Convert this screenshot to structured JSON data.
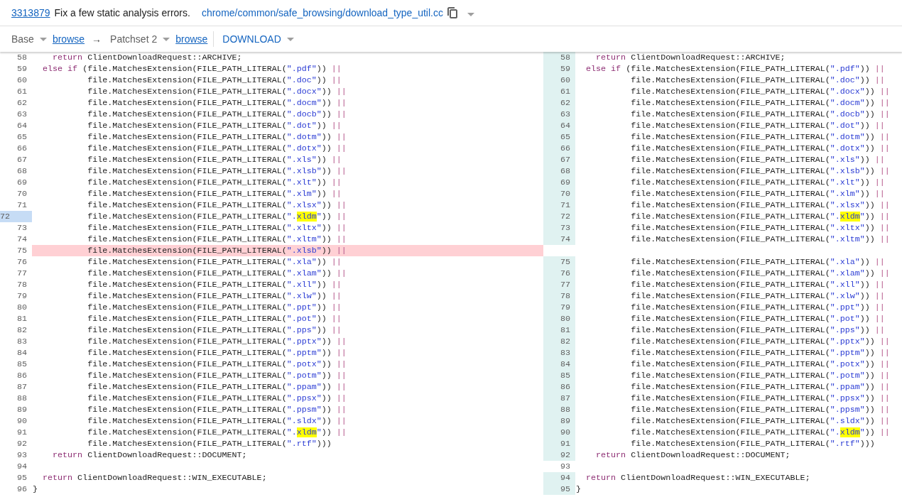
{
  "header": {
    "change_number": "3313879",
    "subject": "Fix a few static analysis errors.",
    "file_path": "chrome/common/safe_browsing/download_type_util.cc"
  },
  "patch_bar": {
    "base": "Base",
    "base_browse": "browse",
    "arrow": "→",
    "patchset": "Patchset 2",
    "patchset_browse": "browse",
    "download": "DOWNLOAD"
  },
  "left": {
    "rows": [
      {
        "number": "58",
        "kind": "context",
        "selected": false,
        "tokens": [
          {
            "kind": "keyword",
            "text": "    return"
          },
          {
            "kind": "plain",
            "text": " ClientDownloadRequest::ARCHIVE;"
          }
        ]
      },
      {
        "number": "59",
        "kind": "context",
        "selected": false,
        "tokens": [
          {
            "kind": "keyword",
            "text": "  else if"
          },
          {
            "kind": "plain",
            "text": " (file.MatchesExtension(FILE_PATH_LITERAL("
          },
          {
            "kind": "string",
            "text": "\".pdf\""
          },
          {
            "kind": "plain",
            "text": ")) "
          },
          {
            "kind": "operator",
            "text": "||"
          }
        ]
      },
      {
        "number": "60",
        "kind": "context",
        "selected": false,
        "tokens": [
          {
            "kind": "plain",
            "text": "           file.MatchesExtension(FILE_PATH_LITERAL("
          },
          {
            "kind": "string",
            "text": "\".doc\""
          },
          {
            "kind": "plain",
            "text": ")) "
          },
          {
            "kind": "operator",
            "text": "||"
          }
        ]
      },
      {
        "number": "61",
        "kind": "context",
        "selected": false,
        "tokens": [
          {
            "kind": "plain",
            "text": "           file.MatchesExtension(FILE_PATH_LITERAL("
          },
          {
            "kind": "string",
            "text": "\".docx\""
          },
          {
            "kind": "plain",
            "text": ")) "
          },
          {
            "kind": "operator",
            "text": "||"
          }
        ]
      },
      {
        "number": "62",
        "kind": "context",
        "selected": false,
        "tokens": [
          {
            "kind": "plain",
            "text": "           file.MatchesExtension(FILE_PATH_LITERAL("
          },
          {
            "kind": "string",
            "text": "\".docm\""
          },
          {
            "kind": "plain",
            "text": ")) "
          },
          {
            "kind": "operator",
            "text": "||"
          }
        ]
      },
      {
        "number": "63",
        "kind": "context",
        "selected": false,
        "tokens": [
          {
            "kind": "plain",
            "text": "           file.MatchesExtension(FILE_PATH_LITERAL("
          },
          {
            "kind": "string",
            "text": "\".docb\""
          },
          {
            "kind": "plain",
            "text": ")) "
          },
          {
            "kind": "operator",
            "text": "||"
          }
        ]
      },
      {
        "number": "64",
        "kind": "context",
        "selected": false,
        "tokens": [
          {
            "kind": "plain",
            "text": "           file.MatchesExtension(FILE_PATH_LITERAL("
          },
          {
            "kind": "string",
            "text": "\".dot\""
          },
          {
            "kind": "plain",
            "text": ")) "
          },
          {
            "kind": "operator",
            "text": "||"
          }
        ]
      },
      {
        "number": "65",
        "kind": "context",
        "selected": false,
        "tokens": [
          {
            "kind": "plain",
            "text": "           file.MatchesExtension(FILE_PATH_LITERAL("
          },
          {
            "kind": "string",
            "text": "\".dotm\""
          },
          {
            "kind": "plain",
            "text": ")) "
          },
          {
            "kind": "operator",
            "text": "||"
          }
        ]
      },
      {
        "number": "66",
        "kind": "context",
        "selected": false,
        "tokens": [
          {
            "kind": "plain",
            "text": "           file.MatchesExtension(FILE_PATH_LITERAL("
          },
          {
            "kind": "string",
            "text": "\".dotx\""
          },
          {
            "kind": "plain",
            "text": ")) "
          },
          {
            "kind": "operator",
            "text": "||"
          }
        ]
      },
      {
        "number": "67",
        "kind": "context",
        "selected": false,
        "tokens": [
          {
            "kind": "plain",
            "text": "           file.MatchesExtension(FILE_PATH_LITERAL("
          },
          {
            "kind": "string",
            "text": "\".xls\""
          },
          {
            "kind": "plain",
            "text": ")) "
          },
          {
            "kind": "operator",
            "text": "||"
          }
        ]
      },
      {
        "number": "68",
        "kind": "context",
        "selected": false,
        "tokens": [
          {
            "kind": "plain",
            "text": "           file.MatchesExtension(FILE_PATH_LITERAL("
          },
          {
            "kind": "string",
            "text": "\".xlsb\""
          },
          {
            "kind": "plain",
            "text": ")) "
          },
          {
            "kind": "operator",
            "text": "||"
          }
        ]
      },
      {
        "number": "69",
        "kind": "context",
        "selected": false,
        "tokens": [
          {
            "kind": "plain",
            "text": "           file.MatchesExtension(FILE_PATH_LITERAL("
          },
          {
            "kind": "string",
            "text": "\".xlt\""
          },
          {
            "kind": "plain",
            "text": ")) "
          },
          {
            "kind": "operator",
            "text": "||"
          }
        ]
      },
      {
        "number": "70",
        "kind": "context",
        "selected": false,
        "tokens": [
          {
            "kind": "plain",
            "text": "           file.MatchesExtension(FILE_PATH_LITERAL("
          },
          {
            "kind": "string",
            "text": "\".xlm\""
          },
          {
            "kind": "plain",
            "text": ")) "
          },
          {
            "kind": "operator",
            "text": "||"
          }
        ]
      },
      {
        "number": "71",
        "kind": "context",
        "selected": false,
        "tokens": [
          {
            "kind": "plain",
            "text": "           file.MatchesExtension(FILE_PATH_LITERAL("
          },
          {
            "kind": "string",
            "text": "\".xlsx\""
          },
          {
            "kind": "plain",
            "text": ")) "
          },
          {
            "kind": "operator",
            "text": "||"
          }
        ]
      },
      {
        "number": "72",
        "kind": "context",
        "selected": true,
        "tokens": [
          {
            "kind": "plain",
            "text": "           file.MatchesExtension(FILE_PATH_LITERAL("
          },
          {
            "kind": "string",
            "text": "\"."
          },
          {
            "kind": "match",
            "text": "xldm"
          },
          {
            "kind": "string",
            "text": "\""
          },
          {
            "kind": "plain",
            "text": ")) "
          },
          {
            "kind": "operator",
            "text": "||"
          }
        ]
      },
      {
        "number": "73",
        "kind": "context",
        "selected": false,
        "tokens": [
          {
            "kind": "plain",
            "text": "           file.MatchesExtension(FILE_PATH_LITERAL("
          },
          {
            "kind": "string",
            "text": "\".xltx\""
          },
          {
            "kind": "plain",
            "text": ")) "
          },
          {
            "kind": "operator",
            "text": "||"
          }
        ]
      },
      {
        "number": "74",
        "kind": "context",
        "selected": false,
        "tokens": [
          {
            "kind": "plain",
            "text": "           file.MatchesExtension(FILE_PATH_LITERAL("
          },
          {
            "kind": "string",
            "text": "\".xltm\""
          },
          {
            "kind": "plain",
            "text": ")) "
          },
          {
            "kind": "operator",
            "text": "||"
          }
        ]
      },
      {
        "number": "75",
        "kind": "removed",
        "selected": false,
        "tokens": [
          {
            "kind": "plain",
            "text": "           file.MatchesExtension(FILE_PATH_LITERAL("
          },
          {
            "kind": "string",
            "text": "\".xlsb\""
          },
          {
            "kind": "plain",
            "text": ")) "
          },
          {
            "kind": "operator",
            "text": "||"
          }
        ]
      },
      {
        "number": "76",
        "kind": "context",
        "selected": false,
        "tokens": [
          {
            "kind": "plain",
            "text": "           file.MatchesExtension(FILE_PATH_LITERAL("
          },
          {
            "kind": "string",
            "text": "\".xla\""
          },
          {
            "kind": "plain",
            "text": ")) "
          },
          {
            "kind": "operator",
            "text": "||"
          }
        ]
      },
      {
        "number": "77",
        "kind": "context",
        "selected": false,
        "tokens": [
          {
            "kind": "plain",
            "text": "           file.MatchesExtension(FILE_PATH_LITERAL("
          },
          {
            "kind": "string",
            "text": "\".xlam\""
          },
          {
            "kind": "plain",
            "text": ")) "
          },
          {
            "kind": "operator",
            "text": "||"
          }
        ]
      },
      {
        "number": "78",
        "kind": "context",
        "selected": false,
        "tokens": [
          {
            "kind": "plain",
            "text": "           file.MatchesExtension(FILE_PATH_LITERAL("
          },
          {
            "kind": "string",
            "text": "\".xll\""
          },
          {
            "kind": "plain",
            "text": ")) "
          },
          {
            "kind": "operator",
            "text": "||"
          }
        ]
      },
      {
        "number": "79",
        "kind": "context",
        "selected": false,
        "tokens": [
          {
            "kind": "plain",
            "text": "           file.MatchesExtension(FILE_PATH_LITERAL("
          },
          {
            "kind": "string",
            "text": "\".xlw\""
          },
          {
            "kind": "plain",
            "text": ")) "
          },
          {
            "kind": "operator",
            "text": "||"
          }
        ]
      },
      {
        "number": "80",
        "kind": "context",
        "selected": false,
        "tokens": [
          {
            "kind": "plain",
            "text": "           file.MatchesExtension(FILE_PATH_LITERAL("
          },
          {
            "kind": "string",
            "text": "\".ppt\""
          },
          {
            "kind": "plain",
            "text": ")) "
          },
          {
            "kind": "operator",
            "text": "||"
          }
        ]
      },
      {
        "number": "81",
        "kind": "context",
        "selected": false,
        "tokens": [
          {
            "kind": "plain",
            "text": "           file.MatchesExtension(FILE_PATH_LITERAL("
          },
          {
            "kind": "string",
            "text": "\".pot\""
          },
          {
            "kind": "plain",
            "text": ")) "
          },
          {
            "kind": "operator",
            "text": "||"
          }
        ]
      },
      {
        "number": "82",
        "kind": "context",
        "selected": false,
        "tokens": [
          {
            "kind": "plain",
            "text": "           file.MatchesExtension(FILE_PATH_LITERAL("
          },
          {
            "kind": "string",
            "text": "\".pps\""
          },
          {
            "kind": "plain",
            "text": ")) "
          },
          {
            "kind": "operator",
            "text": "||"
          }
        ]
      },
      {
        "number": "83",
        "kind": "context",
        "selected": false,
        "tokens": [
          {
            "kind": "plain",
            "text": "           file.MatchesExtension(FILE_PATH_LITERAL("
          },
          {
            "kind": "string",
            "text": "\".pptx\""
          },
          {
            "kind": "plain",
            "text": ")) "
          },
          {
            "kind": "operator",
            "text": "||"
          }
        ]
      },
      {
        "number": "84",
        "kind": "context",
        "selected": false,
        "tokens": [
          {
            "kind": "plain",
            "text": "           file.MatchesExtension(FILE_PATH_LITERAL("
          },
          {
            "kind": "string",
            "text": "\".pptm\""
          },
          {
            "kind": "plain",
            "text": ")) "
          },
          {
            "kind": "operator",
            "text": "||"
          }
        ]
      },
      {
        "number": "85",
        "kind": "context",
        "selected": false,
        "tokens": [
          {
            "kind": "plain",
            "text": "           file.MatchesExtension(FILE_PATH_LITERAL("
          },
          {
            "kind": "string",
            "text": "\".potx\""
          },
          {
            "kind": "plain",
            "text": ")) "
          },
          {
            "kind": "operator",
            "text": "||"
          }
        ]
      },
      {
        "number": "86",
        "kind": "context",
        "selected": false,
        "tokens": [
          {
            "kind": "plain",
            "text": "           file.MatchesExtension(FILE_PATH_LITERAL("
          },
          {
            "kind": "string",
            "text": "\".potm\""
          },
          {
            "kind": "plain",
            "text": ")) "
          },
          {
            "kind": "operator",
            "text": "||"
          }
        ]
      },
      {
        "number": "87",
        "kind": "context",
        "selected": false,
        "tokens": [
          {
            "kind": "plain",
            "text": "           file.MatchesExtension(FILE_PATH_LITERAL("
          },
          {
            "kind": "string",
            "text": "\".ppam\""
          },
          {
            "kind": "plain",
            "text": ")) "
          },
          {
            "kind": "operator",
            "text": "||"
          }
        ]
      },
      {
        "number": "88",
        "kind": "context",
        "selected": false,
        "tokens": [
          {
            "kind": "plain",
            "text": "           file.MatchesExtension(FILE_PATH_LITERAL("
          },
          {
            "kind": "string",
            "text": "\".ppsx\""
          },
          {
            "kind": "plain",
            "text": ")) "
          },
          {
            "kind": "operator",
            "text": "||"
          }
        ]
      },
      {
        "number": "89",
        "kind": "context",
        "selected": false,
        "tokens": [
          {
            "kind": "plain",
            "text": "           file.MatchesExtension(FILE_PATH_LITERAL("
          },
          {
            "kind": "string",
            "text": "\".ppsm\""
          },
          {
            "kind": "plain",
            "text": ")) "
          },
          {
            "kind": "operator",
            "text": "||"
          }
        ]
      },
      {
        "number": "90",
        "kind": "context",
        "selected": false,
        "tokens": [
          {
            "kind": "plain",
            "text": "           file.MatchesExtension(FILE_PATH_LITERAL("
          },
          {
            "kind": "string",
            "text": "\".sldx\""
          },
          {
            "kind": "plain",
            "text": ")) "
          },
          {
            "kind": "operator",
            "text": "||"
          }
        ]
      },
      {
        "number": "91",
        "kind": "context",
        "selected": false,
        "tokens": [
          {
            "kind": "plain",
            "text": "           file.MatchesExtension(FILE_PATH_LITERAL("
          },
          {
            "kind": "string",
            "text": "\"."
          },
          {
            "kind": "match",
            "text": "xldm"
          },
          {
            "kind": "string",
            "text": "\""
          },
          {
            "kind": "plain",
            "text": ")) "
          },
          {
            "kind": "operator",
            "text": "||"
          }
        ]
      },
      {
        "number": "92",
        "kind": "context",
        "selected": false,
        "tokens": [
          {
            "kind": "plain",
            "text": "           file.MatchesExtension(FILE_PATH_LITERAL("
          },
          {
            "kind": "string",
            "text": "\".rtf\""
          },
          {
            "kind": "plain",
            "text": ")))"
          }
        ]
      },
      {
        "number": "93",
        "kind": "context",
        "selected": false,
        "tokens": [
          {
            "kind": "keyword",
            "text": "    return"
          },
          {
            "kind": "plain",
            "text": " ClientDownloadRequest::DOCUMENT;"
          }
        ]
      },
      {
        "number": "94",
        "kind": "context",
        "selected": false
      },
      {
        "number": "95",
        "kind": "context",
        "selected": false,
        "tokens": [
          {
            "kind": "keyword",
            "text": "  return"
          },
          {
            "kind": "plain",
            "text": " ClientDownloadRequest::WIN_EXECUTABLE;"
          }
        ]
      },
      {
        "number": "96",
        "kind": "context",
        "selected": false,
        "tokens": [
          {
            "kind": "plain",
            "text": "}"
          }
        ]
      }
    ]
  },
  "right": {
    "rows": [
      {
        "number": "58",
        "kind": "context",
        "covered": true,
        "tokens": [
          {
            "kind": "keyword",
            "text": "    return"
          },
          {
            "kind": "plain",
            "text": " ClientDownloadRequest::ARCHIVE;"
          }
        ]
      },
      {
        "number": "59",
        "kind": "context",
        "covered": true,
        "tokens": [
          {
            "kind": "keyword",
            "text": "  else if"
          },
          {
            "kind": "plain",
            "text": " (file.MatchesExtension(FILE_PATH_LITERAL("
          },
          {
            "kind": "string",
            "text": "\".pdf\""
          },
          {
            "kind": "plain",
            "text": ")) "
          },
          {
            "kind": "operator",
            "text": "||"
          }
        ]
      },
      {
        "number": "60",
        "kind": "context",
        "covered": true,
        "tokens": [
          {
            "kind": "plain",
            "text": "           file.MatchesExtension(FILE_PATH_LITERAL("
          },
          {
            "kind": "string",
            "text": "\".doc\""
          },
          {
            "kind": "plain",
            "text": ")) "
          },
          {
            "kind": "operator",
            "text": "||"
          }
        ]
      },
      {
        "number": "61",
        "kind": "context",
        "covered": true,
        "tokens": [
          {
            "kind": "plain",
            "text": "           file.MatchesExtension(FILE_PATH_LITERAL("
          },
          {
            "kind": "string",
            "text": "\".docx\""
          },
          {
            "kind": "plain",
            "text": ")) "
          },
          {
            "kind": "operator",
            "text": "||"
          }
        ]
      },
      {
        "number": "62",
        "kind": "context",
        "covered": true,
        "tokens": [
          {
            "kind": "plain",
            "text": "           file.MatchesExtension(FILE_PATH_LITERAL("
          },
          {
            "kind": "string",
            "text": "\".docm\""
          },
          {
            "kind": "plain",
            "text": ")) "
          },
          {
            "kind": "operator",
            "text": "||"
          }
        ]
      },
      {
        "number": "63",
        "kind": "context",
        "covered": true,
        "tokens": [
          {
            "kind": "plain",
            "text": "           file.MatchesExtension(FILE_PATH_LITERAL("
          },
          {
            "kind": "string",
            "text": "\".docb\""
          },
          {
            "kind": "plain",
            "text": ")) "
          },
          {
            "kind": "operator",
            "text": "||"
          }
        ]
      },
      {
        "number": "64",
        "kind": "context",
        "covered": true,
        "tokens": [
          {
            "kind": "plain",
            "text": "           file.MatchesExtension(FILE_PATH_LITERAL("
          },
          {
            "kind": "string",
            "text": "\".dot\""
          },
          {
            "kind": "plain",
            "text": ")) "
          },
          {
            "kind": "operator",
            "text": "||"
          }
        ]
      },
      {
        "number": "65",
        "kind": "context",
        "covered": true,
        "tokens": [
          {
            "kind": "plain",
            "text": "           file.MatchesExtension(FILE_PATH_LITERAL("
          },
          {
            "kind": "string",
            "text": "\".dotm\""
          },
          {
            "kind": "plain",
            "text": ")) "
          },
          {
            "kind": "operator",
            "text": "||"
          }
        ]
      },
      {
        "number": "66",
        "kind": "context",
        "covered": true,
        "tokens": [
          {
            "kind": "plain",
            "text": "           file.MatchesExtension(FILE_PATH_LITERAL("
          },
          {
            "kind": "string",
            "text": "\".dotx\""
          },
          {
            "kind": "plain",
            "text": ")) "
          },
          {
            "kind": "operator",
            "text": "||"
          }
        ]
      },
      {
        "number": "67",
        "kind": "context",
        "covered": true,
        "tokens": [
          {
            "kind": "plain",
            "text": "           file.MatchesExtension(FILE_PATH_LITERAL("
          },
          {
            "kind": "string",
            "text": "\".xls\""
          },
          {
            "kind": "plain",
            "text": ")) "
          },
          {
            "kind": "operator",
            "text": "||"
          }
        ]
      },
      {
        "number": "68",
        "kind": "context",
        "covered": true,
        "tokens": [
          {
            "kind": "plain",
            "text": "           file.MatchesExtension(FILE_PATH_LITERAL("
          },
          {
            "kind": "string",
            "text": "\".xlsb\""
          },
          {
            "kind": "plain",
            "text": ")) "
          },
          {
            "kind": "operator",
            "text": "||"
          }
        ]
      },
      {
        "number": "69",
        "kind": "context",
        "covered": true,
        "tokens": [
          {
            "kind": "plain",
            "text": "           file.MatchesExtension(FILE_PATH_LITERAL("
          },
          {
            "kind": "string",
            "text": "\".xlt\""
          },
          {
            "kind": "plain",
            "text": ")) "
          },
          {
            "kind": "operator",
            "text": "||"
          }
        ]
      },
      {
        "number": "70",
        "kind": "context",
        "covered": true,
        "tokens": [
          {
            "kind": "plain",
            "text": "           file.MatchesExtension(FILE_PATH_LITERAL("
          },
          {
            "kind": "string",
            "text": "\".xlm\""
          },
          {
            "kind": "plain",
            "text": ")) "
          },
          {
            "kind": "operator",
            "text": "||"
          }
        ]
      },
      {
        "number": "71",
        "kind": "context",
        "covered": true,
        "tokens": [
          {
            "kind": "plain",
            "text": "           file.MatchesExtension(FILE_PATH_LITERAL("
          },
          {
            "kind": "string",
            "text": "\".xlsx\""
          },
          {
            "kind": "plain",
            "text": ")) "
          },
          {
            "kind": "operator",
            "text": "||"
          }
        ]
      },
      {
        "number": "72",
        "kind": "context",
        "covered": true,
        "tokens": [
          {
            "kind": "plain",
            "text": "           file.MatchesExtension(FILE_PATH_LITERAL("
          },
          {
            "kind": "string",
            "text": "\"."
          },
          {
            "kind": "match",
            "text": "xldm"
          },
          {
            "kind": "string",
            "text": "\""
          },
          {
            "kind": "plain",
            "text": ")) "
          },
          {
            "kind": "operator",
            "text": "||"
          }
        ]
      },
      {
        "number": "73",
        "kind": "context",
        "covered": true,
        "tokens": [
          {
            "kind": "plain",
            "text": "           file.MatchesExtension(FILE_PATH_LITERAL("
          },
          {
            "kind": "string",
            "text": "\".xltx\""
          },
          {
            "kind": "plain",
            "text": ")) "
          },
          {
            "kind": "operator",
            "text": "||"
          }
        ]
      },
      {
        "number": "74",
        "kind": "context",
        "covered": true,
        "tokens": [
          {
            "kind": "plain",
            "text": "           file.MatchesExtension(FILE_PATH_LITERAL("
          },
          {
            "kind": "string",
            "text": "\".xltm\""
          },
          {
            "kind": "plain",
            "text": ")) "
          },
          {
            "kind": "operator",
            "text": "||"
          }
        ]
      },
      {
        "kind": "blank",
        "covered": false
      },
      {
        "number": "75",
        "kind": "context",
        "covered": true,
        "tokens": [
          {
            "kind": "plain",
            "text": "           file.MatchesExtension(FILE_PATH_LITERAL("
          },
          {
            "kind": "string",
            "text": "\".xla\""
          },
          {
            "kind": "plain",
            "text": ")) "
          },
          {
            "kind": "operator",
            "text": "||"
          }
        ]
      },
      {
        "number": "76",
        "kind": "context",
        "covered": true,
        "tokens": [
          {
            "kind": "plain",
            "text": "           file.MatchesExtension(FILE_PATH_LITERAL("
          },
          {
            "kind": "string",
            "text": "\".xlam\""
          },
          {
            "kind": "plain",
            "text": ")) "
          },
          {
            "kind": "operator",
            "text": "||"
          }
        ]
      },
      {
        "number": "77",
        "kind": "context",
        "covered": true,
        "tokens": [
          {
            "kind": "plain",
            "text": "           file.MatchesExtension(FILE_PATH_LITERAL("
          },
          {
            "kind": "string",
            "text": "\".xll\""
          },
          {
            "kind": "plain",
            "text": ")) "
          },
          {
            "kind": "operator",
            "text": "||"
          }
        ]
      },
      {
        "number": "78",
        "kind": "context",
        "covered": true,
        "tokens": [
          {
            "kind": "plain",
            "text": "           file.MatchesExtension(FILE_PATH_LITERAL("
          },
          {
            "kind": "string",
            "text": "\".xlw\""
          },
          {
            "kind": "plain",
            "text": ")) "
          },
          {
            "kind": "operator",
            "text": "||"
          }
        ]
      },
      {
        "number": "79",
        "kind": "context",
        "covered": true,
        "tokens": [
          {
            "kind": "plain",
            "text": "           file.MatchesExtension(FILE_PATH_LITERAL("
          },
          {
            "kind": "string",
            "text": "\".ppt\""
          },
          {
            "kind": "plain",
            "text": ")) "
          },
          {
            "kind": "operator",
            "text": "||"
          }
        ]
      },
      {
        "number": "80",
        "kind": "context",
        "covered": true,
        "tokens": [
          {
            "kind": "plain",
            "text": "           file.MatchesExtension(FILE_PATH_LITERAL("
          },
          {
            "kind": "string",
            "text": "\".pot\""
          },
          {
            "kind": "plain",
            "text": ")) "
          },
          {
            "kind": "operator",
            "text": "||"
          }
        ]
      },
      {
        "number": "81",
        "kind": "context",
        "covered": true,
        "tokens": [
          {
            "kind": "plain",
            "text": "           file.MatchesExtension(FILE_PATH_LITERAL("
          },
          {
            "kind": "string",
            "text": "\".pps\""
          },
          {
            "kind": "plain",
            "text": ")) "
          },
          {
            "kind": "operator",
            "text": "||"
          }
        ]
      },
      {
        "number": "82",
        "kind": "context",
        "covered": true,
        "tokens": [
          {
            "kind": "plain",
            "text": "           file.MatchesExtension(FILE_PATH_LITERAL("
          },
          {
            "kind": "string",
            "text": "\".pptx\""
          },
          {
            "kind": "plain",
            "text": ")) "
          },
          {
            "kind": "operator",
            "text": "||"
          }
        ]
      },
      {
        "number": "83",
        "kind": "context",
        "covered": true,
        "tokens": [
          {
            "kind": "plain",
            "text": "           file.MatchesExtension(FILE_PATH_LITERAL("
          },
          {
            "kind": "string",
            "text": "\".pptm\""
          },
          {
            "kind": "plain",
            "text": ")) "
          },
          {
            "kind": "operator",
            "text": "||"
          }
        ]
      },
      {
        "number": "84",
        "kind": "context",
        "covered": true,
        "tokens": [
          {
            "kind": "plain",
            "text": "           file.MatchesExtension(FILE_PATH_LITERAL("
          },
          {
            "kind": "string",
            "text": "\".potx\""
          },
          {
            "kind": "plain",
            "text": ")) "
          },
          {
            "kind": "operator",
            "text": "||"
          }
        ]
      },
      {
        "number": "85",
        "kind": "context",
        "covered": true,
        "tokens": [
          {
            "kind": "plain",
            "text": "           file.MatchesExtension(FILE_PATH_LITERAL("
          },
          {
            "kind": "string",
            "text": "\".potm\""
          },
          {
            "kind": "plain",
            "text": ")) "
          },
          {
            "kind": "operator",
            "text": "||"
          }
        ]
      },
      {
        "number": "86",
        "kind": "context",
        "covered": true,
        "tokens": [
          {
            "kind": "plain",
            "text": "           file.MatchesExtension(FILE_PATH_LITERAL("
          },
          {
            "kind": "string",
            "text": "\".ppam\""
          },
          {
            "kind": "plain",
            "text": ")) "
          },
          {
            "kind": "operator",
            "text": "||"
          }
        ]
      },
      {
        "number": "87",
        "kind": "context",
        "covered": true,
        "tokens": [
          {
            "kind": "plain",
            "text": "           file.MatchesExtension(FILE_PATH_LITERAL("
          },
          {
            "kind": "string",
            "text": "\".ppsx\""
          },
          {
            "kind": "plain",
            "text": ")) "
          },
          {
            "kind": "operator",
            "text": "||"
          }
        ]
      },
      {
        "number": "88",
        "kind": "context",
        "covered": true,
        "tokens": [
          {
            "kind": "plain",
            "text": "           file.MatchesExtension(FILE_PATH_LITERAL("
          },
          {
            "kind": "string",
            "text": "\".ppsm\""
          },
          {
            "kind": "plain",
            "text": ")) "
          },
          {
            "kind": "operator",
            "text": "||"
          }
        ]
      },
      {
        "number": "89",
        "kind": "context",
        "covered": true,
        "tokens": [
          {
            "kind": "plain",
            "text": "           file.MatchesExtension(FILE_PATH_LITERAL("
          },
          {
            "kind": "string",
            "text": "\".sldx\""
          },
          {
            "kind": "plain",
            "text": ")) "
          },
          {
            "kind": "operator",
            "text": "||"
          }
        ]
      },
      {
        "number": "90",
        "kind": "context",
        "covered": true,
        "tokens": [
          {
            "kind": "plain",
            "text": "           file.MatchesExtension(FILE_PATH_LITERAL("
          },
          {
            "kind": "string",
            "text": "\"."
          },
          {
            "kind": "match",
            "text": "xldm"
          },
          {
            "kind": "string",
            "text": "\""
          },
          {
            "kind": "plain",
            "text": ")) "
          },
          {
            "kind": "operator",
            "text": "||"
          }
        ]
      },
      {
        "number": "91",
        "kind": "context",
        "covered": true,
        "tokens": [
          {
            "kind": "plain",
            "text": "           file.MatchesExtension(FILE_PATH_LITERAL("
          },
          {
            "kind": "string",
            "text": "\".rtf\""
          },
          {
            "kind": "plain",
            "text": ")))"
          }
        ]
      },
      {
        "number": "92",
        "kind": "context",
        "covered": true,
        "tokens": [
          {
            "kind": "keyword",
            "text": "    return"
          },
          {
            "kind": "plain",
            "text": " ClientDownloadRequest::DOCUMENT;"
          }
        ]
      },
      {
        "number": "93",
        "kind": "context",
        "covered": false
      },
      {
        "number": "94",
        "kind": "context",
        "covered": true,
        "tokens": [
          {
            "kind": "keyword",
            "text": "  return"
          },
          {
            "kind": "plain",
            "text": " ClientDownloadRequest::WIN_EXECUTABLE;"
          }
        ]
      },
      {
        "number": "95",
        "kind": "context",
        "covered": true,
        "tokens": [
          {
            "kind": "plain",
            "text": "}"
          }
        ]
      }
    ]
  }
}
